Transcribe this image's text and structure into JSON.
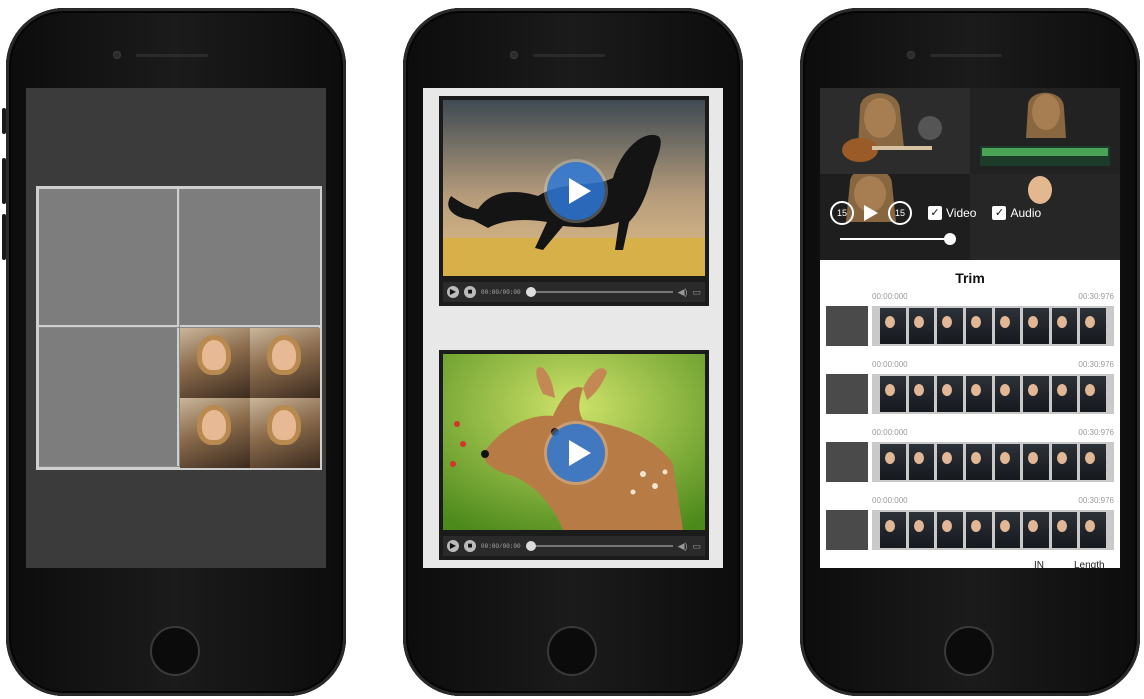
{
  "phone3": {
    "controls": {
      "skip_back_label": "15",
      "skip_forward_label": "15",
      "video_label": "Video",
      "audio_label": "Audio",
      "check_mark": "✓"
    },
    "trim": {
      "title": "Trim",
      "tracks": [
        {
          "start": "00:00:000",
          "end": "00:30:976"
        },
        {
          "start": "00:00:000",
          "end": "00:30:976"
        },
        {
          "start": "00:00:000",
          "end": "00:30:976"
        },
        {
          "start": "00:00:000",
          "end": "00:30:976"
        }
      ],
      "footer_in": "IN",
      "footer_length": "Length"
    }
  },
  "colors": {
    "phone_body": "#141414",
    "collage_bg": "#3b3b3b",
    "play_accent": "#2e78d6"
  }
}
